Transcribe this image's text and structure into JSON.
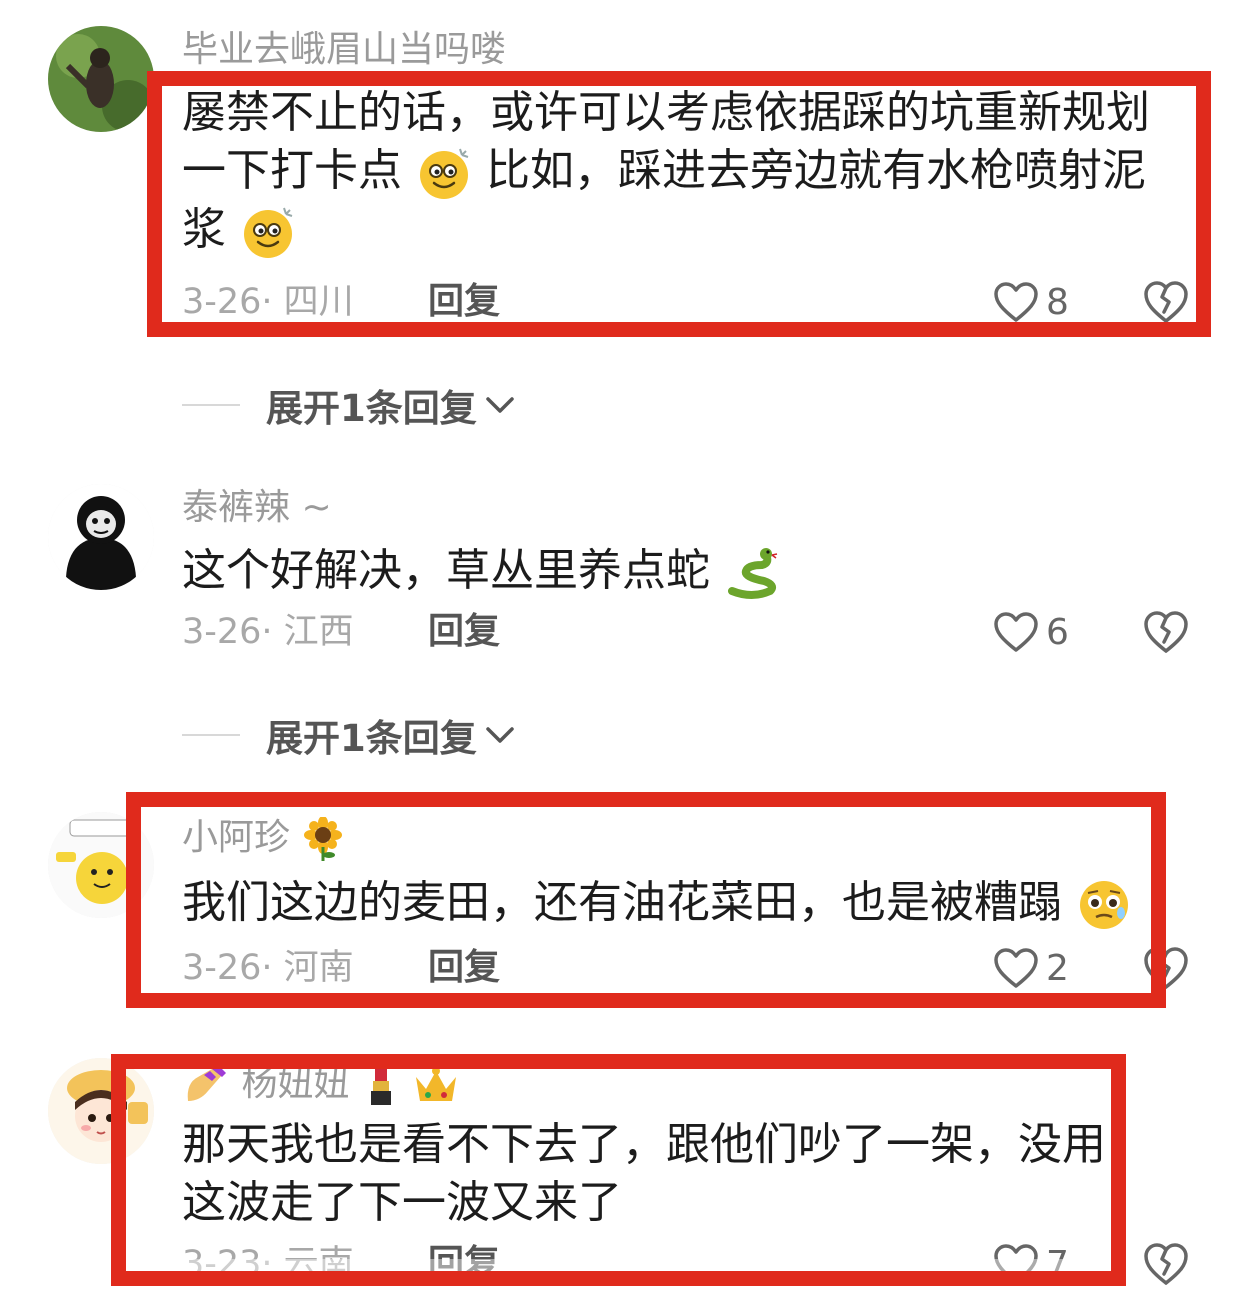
{
  "comments": [
    {
      "username": "毕业去峨眉山当吗喽",
      "text_lines": [
        "屡禁不止的话，或许可以考虑依据踩的坑重新规划",
        "一下打卡点",
        "比如，踩进去旁边就有水枪喷射泥",
        "浆"
      ],
      "date_region": "3-26· 四川",
      "reply_label": "回复",
      "likes": "8",
      "expand_label": "展开1条回复"
    },
    {
      "username": "泰裤辣 ~",
      "text_lines": [
        "这个好解决，草丛里养点蛇"
      ],
      "date_region": "3-26· 江西",
      "reply_label": "回复",
      "likes": "6",
      "expand_label": "展开1条回复"
    },
    {
      "username": "小阿珍",
      "text_lines": [
        "我们这边的麦田，还有油花菜田，也是被糟蹋"
      ],
      "date_region": "3-26· 河南",
      "reply_label": "回复",
      "likes": "2"
    },
    {
      "username": "杨妞妞",
      "text_lines": [
        "那天我也是看不下去了，跟他们吵了一架，没用，",
        "这波走了下一波又来了"
      ],
      "date_region": "3-23· 云南",
      "reply_label": "回复",
      "likes": "7"
    }
  ],
  "colors": {
    "highlight": "#e02a1c"
  },
  "icons": {
    "like": "heart-outline-icon",
    "dislike": "broken-heart-icon",
    "expand": "chevron-down-icon",
    "emoji_dizzy": "dizzy-smile-emoji",
    "emoji_snake": "snake-emoji",
    "emoji_pleading": "pleading-emoji",
    "emoji_sunflower": "sunflower-emoji",
    "emoji_nails": "nail-polish-emoji",
    "emoji_lipstick": "lipstick-emoji",
    "emoji_crown": "crown-emoji"
  }
}
